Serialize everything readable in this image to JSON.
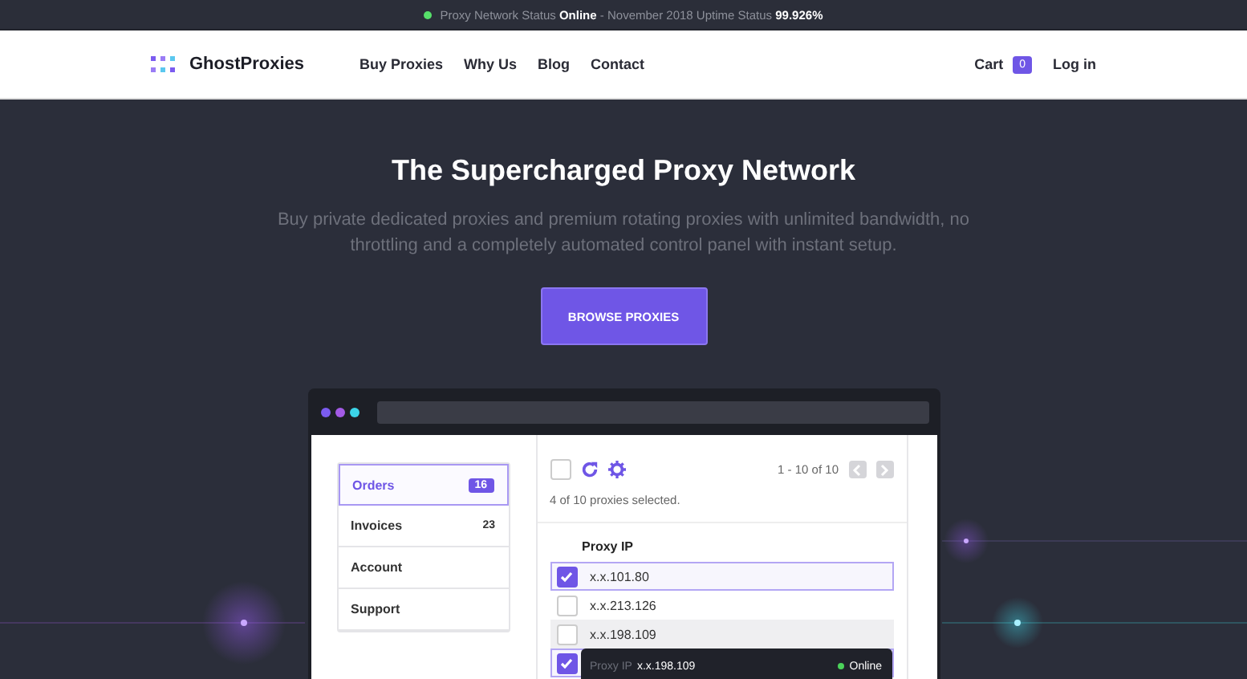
{
  "status_bar": {
    "online": true,
    "text": "Proxy Network Status **Online** - November 2018 Uptime Status **99.926%**"
  },
  "nav": {
    "logo": "GhostProxies",
    "links": [
      "Buy Proxies",
      "Why Us",
      "Blog",
      "Contact"
    ],
    "cart": "Cart",
    "cart_count": "0",
    "login": "Log in"
  },
  "hero": {
    "title": "The Supercharged Proxy Network",
    "subtitle": "Buy private dedicated proxies and premium rotating proxies with unlimited bandwidth, no throttling and a completely automated control panel with instant setup.",
    "button": "BROWSE PROXIES"
  },
  "dashboard": {
    "menu": [
      {
        "label": "Orders",
        "count": "16",
        "selected": true
      },
      {
        "label": "Invoices",
        "count": "23",
        "selected": false
      },
      {
        "label": "Account",
        "selected": false
      },
      {
        "label": "Support",
        "selected": false
      }
    ],
    "select_all": {
      "checked": false
    },
    "pagination": "1 - 10 of 10",
    "selection_text": "4 of 10 proxies selected.",
    "column": "Proxy IP",
    "rows": [
      {
        "ip": "x.x.101.80",
        "checked": true,
        "selected": true,
        "hovered": false
      },
      {
        "ip": "x.x.213.126",
        "checked": false,
        "selected": false,
        "hovered": false
      },
      {
        "ip": "x.x.198.109",
        "checked": false,
        "selected": false,
        "hovered": true
      },
      {
        "checked": true,
        "selected": true,
        "hovered": false
      }
    ],
    "tooltip": {
      "label": "Proxy IP",
      "ip": "x.x.198.109",
      "status": "Online"
    }
  }
}
